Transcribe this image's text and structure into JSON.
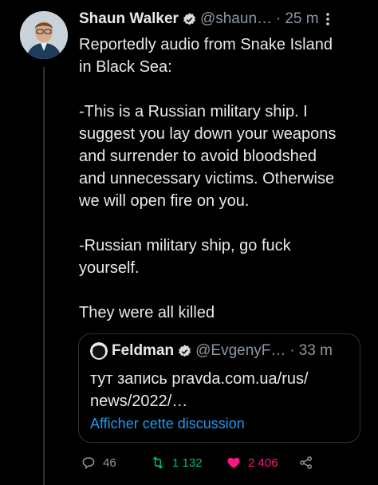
{
  "tweet": {
    "author_name": "Shaun Walker",
    "handle": "@shaun…",
    "separator": "·",
    "time": "25 m",
    "text": "Reportedly audio from Snake Island\nin Black Sea:\n\n-This is a Russian military ship. I\nsuggest you lay down your weapons\nand surrender to avoid bloodshed\nand unnecessary victims. Otherwise\nwe will open fire on you.\n\n-Russian military ship, go fuck\nyourself.\n\nThey were all killed"
  },
  "quote": {
    "author_name": "Feldman",
    "handle": "@EvgenyF…",
    "separator": "·",
    "time": "33 m",
    "text": "тут запись pravda.com.ua/rus/\nnews/2022/…",
    "show_thread_label": "Afficher cette discussion"
  },
  "actions": {
    "reply_count": "46",
    "retweet_count": "1 132",
    "like_count": "2 406"
  },
  "colors": {
    "background": "#000000",
    "text": "#e7e9ea",
    "muted": "#8b98a5",
    "accent": "#1d9bf0",
    "retweet": "#00ba7c",
    "like": "#f91880"
  },
  "icons": [
    "verified-badge-icon",
    "more-options-icon",
    "reply-icon",
    "retweet-icon",
    "like-icon",
    "share-icon"
  ]
}
